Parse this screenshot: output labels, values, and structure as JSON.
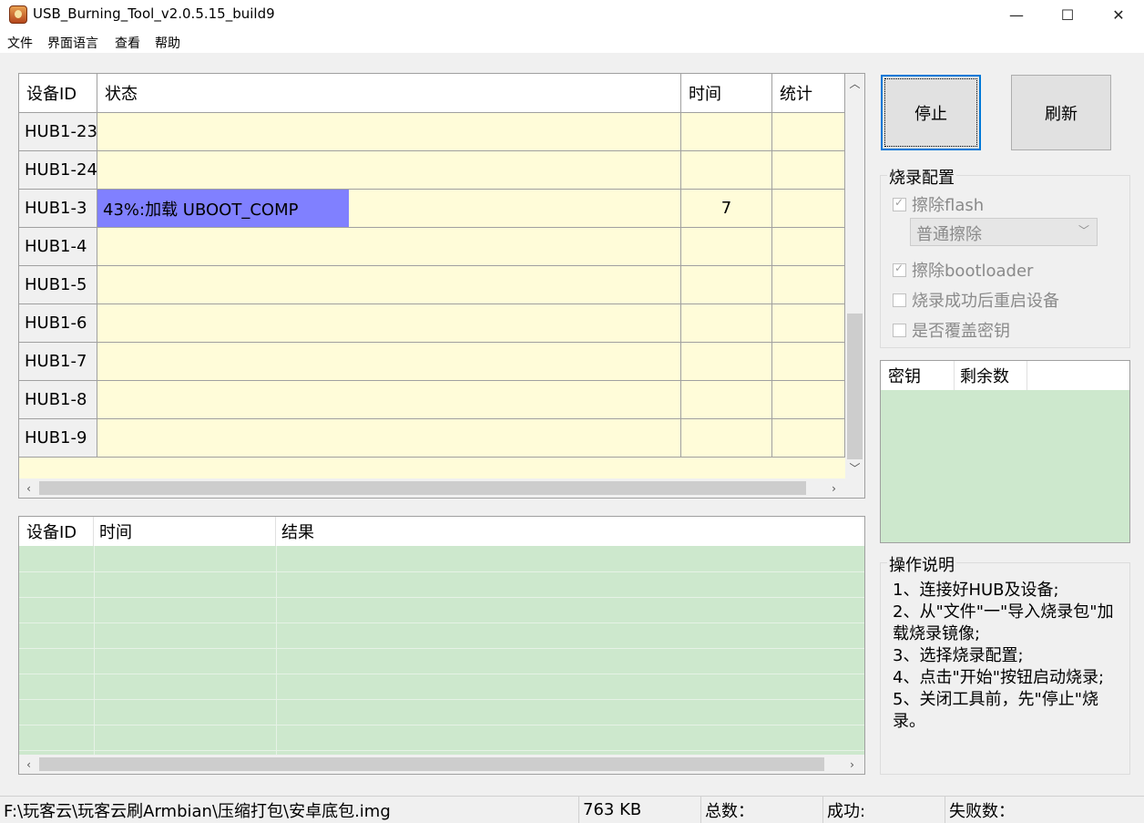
{
  "window": {
    "title": "USB_Burning_Tool_v2.0.5.15_build9",
    "minimize": "—",
    "maximize": "☐",
    "close": "✕"
  },
  "menu": [
    "文件",
    "界面语言",
    "查看",
    "帮助"
  ],
  "device_grid": {
    "columns": [
      "设备ID",
      "状态",
      "时间",
      "统计"
    ],
    "rows": [
      {
        "id": "HUB1-23",
        "status": "",
        "time": "",
        "stat": ""
      },
      {
        "id": "HUB1-24",
        "status": "",
        "time": "",
        "stat": ""
      },
      {
        "id": "HUB1-3",
        "status": "43%:加载 UBOOT_COMP",
        "time": "7",
        "stat": "",
        "progress": 43
      },
      {
        "id": "HUB1-4",
        "status": "",
        "time": "",
        "stat": ""
      },
      {
        "id": "HUB1-5",
        "status": "",
        "time": "",
        "stat": ""
      },
      {
        "id": "HUB1-6",
        "status": "",
        "time": "",
        "stat": ""
      },
      {
        "id": "HUB1-7",
        "status": "",
        "time": "",
        "stat": ""
      },
      {
        "id": "HUB1-8",
        "status": "",
        "time": "",
        "stat": ""
      },
      {
        "id": "HUB1-9",
        "status": "",
        "time": "",
        "stat": ""
      }
    ]
  },
  "log_grid": {
    "columns": [
      "设备ID",
      "时间",
      "结果"
    ]
  },
  "buttons": {
    "stop": "停止",
    "refresh": "刷新"
  },
  "burn_config": {
    "title": "烧录配置",
    "erase_flash": "擦除flash",
    "erase_mode": "普通擦除",
    "erase_bootloader": "擦除bootloader",
    "reboot_after": "烧录成功后重启设备",
    "overwrite_key": "是否覆盖密钥"
  },
  "key_table": {
    "columns": [
      "密钥",
      "剩余数"
    ]
  },
  "instructions": {
    "title": "操作说明",
    "lines": [
      "1、连接好HUB及设备;",
      "2、从\"文件\"一\"导入烧录包\"加载烧录镜像;",
      "3、选择烧录配置;",
      "4、点击\"开始\"按钮启动烧录;",
      "5、关闭工具前，先\"停止\"烧录。"
    ]
  },
  "status_bar": {
    "path": "F:\\玩客云\\玩客云刷Armbian\\压缩打包\\安卓底包.img",
    "size": "763 KB",
    "total": "总数：",
    "success": "成功:",
    "fail": "失败数："
  },
  "colors": {
    "progress": "#8080ff",
    "grid_bg": "#fffcd9",
    "green_bg": "#cde8cd"
  }
}
